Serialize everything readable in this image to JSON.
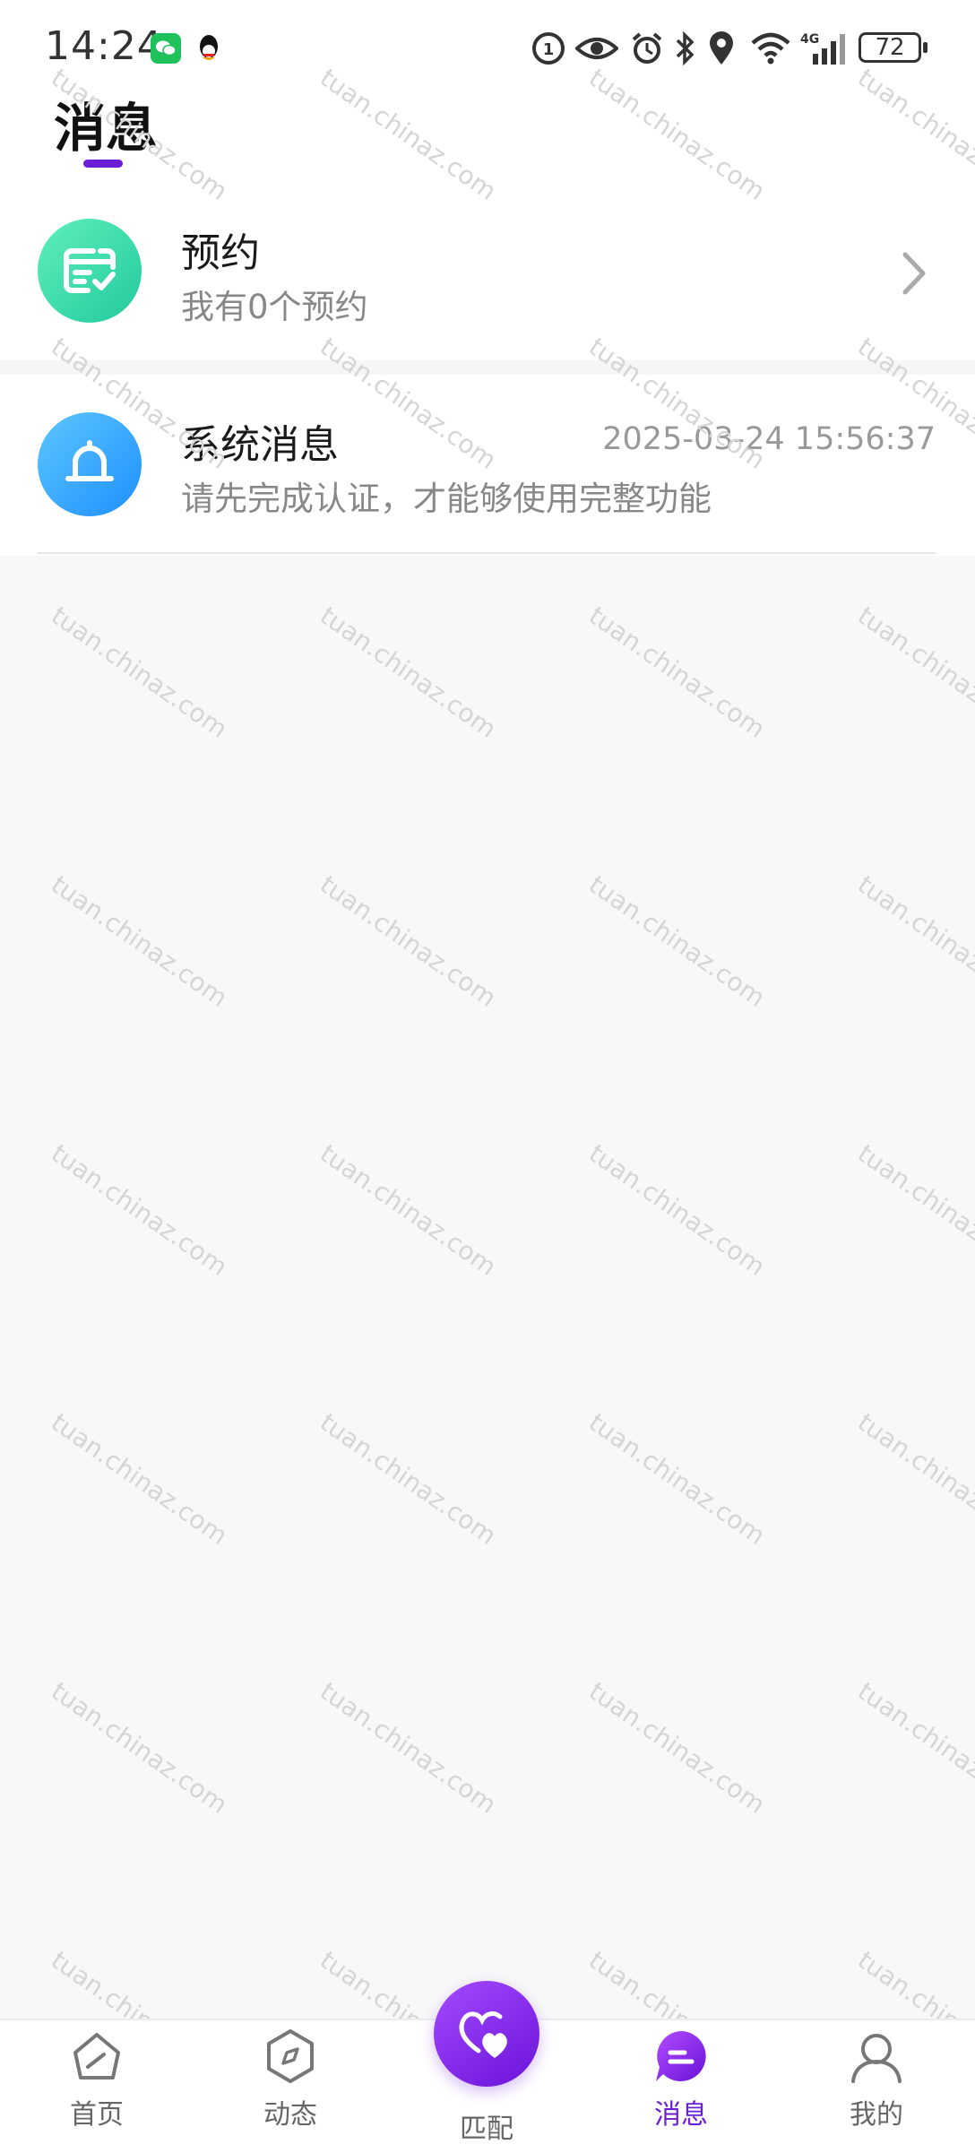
{
  "status_bar": {
    "time": "14:24",
    "battery": "72",
    "network": "4G"
  },
  "header": {
    "title": "消息"
  },
  "appointment": {
    "title": "预约",
    "subtitle": "我有0个预约"
  },
  "system_message": {
    "title": "系统消息",
    "time": "2025-03-24 15:56:37",
    "preview": "请先完成认证，才能够使用完整功能"
  },
  "watermark": {
    "text": "tuan.chinaz.com"
  },
  "bottom_nav": {
    "items": [
      {
        "label": "首页",
        "icon": "home-icon"
      },
      {
        "label": "动态",
        "icon": "compass-icon"
      },
      {
        "label": "匹配",
        "icon": "heart-match-icon"
      },
      {
        "label": "消息",
        "icon": "message-icon"
      },
      {
        "label": "我的",
        "icon": "person-icon"
      }
    ],
    "active_color": "#6a1fd6"
  }
}
